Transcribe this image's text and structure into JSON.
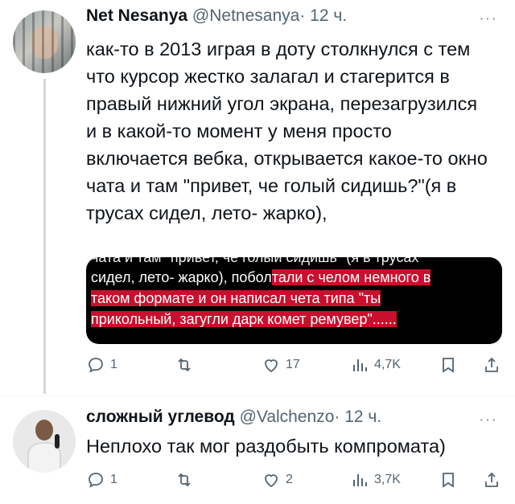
{
  "tweets": [
    {
      "name": "Net Nesanya",
      "handle": "@Netnesanya",
      "dot": "·",
      "time": "12 ч.",
      "text": "как-то в 2013 играя в доту столкнулся с тем что курсор жестко залагал и стагерится в правый нижний угол экрана, перезагрузился и в какой-то момент у меня просто включается вебка, открывается какое-то окно чата и там \"привет, че голый сидишь?\"(я в трусах сидел, лето- жарко),",
      "image": {
        "cut_line": "чата и там \"привет, че голый сидишь\" (я в трусах",
        "line1_plain": "сидел, лето- жарко), побол",
        "line1_highlight": "тали с челом немного в",
        "line2_highlight": "таком формате и он написал чета типа \"ты",
        "line3_highlight": "прикольный, загугли дарк комет ремувер\"......",
        "highlight_color": "#c8102e"
      },
      "actions": {
        "replies": "1",
        "retweets": "",
        "likes": "17",
        "views": "4,7K"
      }
    },
    {
      "name": "сложный углевод",
      "handle": "@Valchenzo",
      "dot": "·",
      "time": "12 ч.",
      "text": "Неплохо так мог раздобыть компромата)",
      "actions": {
        "replies": "1",
        "retweets": "",
        "likes": "2",
        "views": "3,7K"
      }
    }
  ],
  "more_glyph": "···",
  "colors": {
    "text": "#0f1419",
    "secondary": "#536471",
    "thread_line": "#cfd9de"
  }
}
